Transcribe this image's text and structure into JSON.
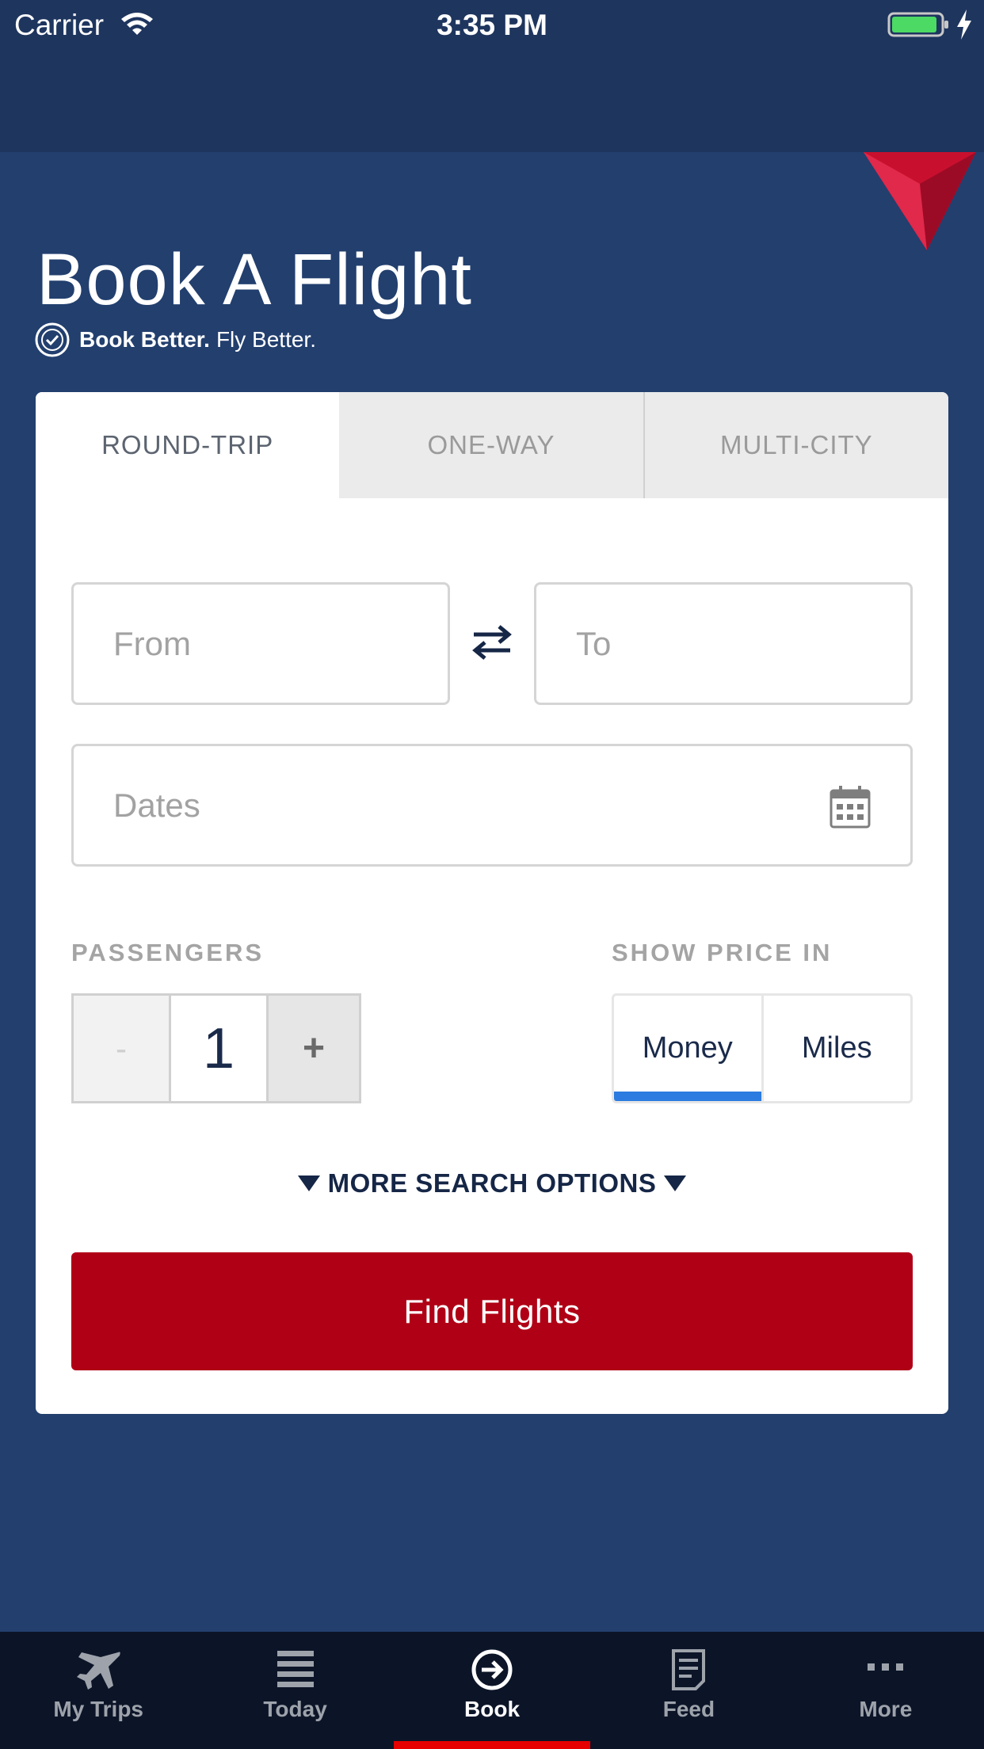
{
  "status_bar": {
    "carrier": "Carrier",
    "time": "3:35 PM"
  },
  "header": {
    "title": "Book A Flight",
    "tagline_bold": "Book Better.",
    "tagline_regular": "Fly Better."
  },
  "trip_tabs": [
    {
      "label": "ROUND-TRIP",
      "active": true
    },
    {
      "label": "ONE-WAY",
      "active": false
    },
    {
      "label": "MULTI-CITY",
      "active": false
    }
  ],
  "form": {
    "from_placeholder": "From",
    "to_placeholder": "To",
    "dates_placeholder": "Dates",
    "passengers_label": "PASSENGERS",
    "passengers_value": "1",
    "stepper_minus": "-",
    "stepper_plus": "+",
    "price_label": "SHOW PRICE IN",
    "price_options": [
      {
        "label": "Money",
        "selected": true
      },
      {
        "label": "Miles",
        "selected": false
      }
    ],
    "more_options": "MORE SEARCH OPTIONS",
    "submit_label": "Find Flights"
  },
  "bottom_nav": [
    {
      "label": "My Trips",
      "icon": "airplane-icon",
      "active": false
    },
    {
      "label": "Today",
      "icon": "list-icon",
      "active": false
    },
    {
      "label": "Book",
      "icon": "book-arrow-icon",
      "active": true
    },
    {
      "label": "Feed",
      "icon": "feed-icon",
      "active": false
    },
    {
      "label": "More",
      "icon": "more-dots-icon",
      "active": false
    }
  ],
  "colors": {
    "background": "#223f6e",
    "status_bar": "#1e355e",
    "primary_button": "#b00016",
    "toggle_accent": "#2b7be0",
    "nav_background": "#0c1528",
    "nav_active_indicator": "#e60000",
    "logo_red": "#c8102e"
  }
}
